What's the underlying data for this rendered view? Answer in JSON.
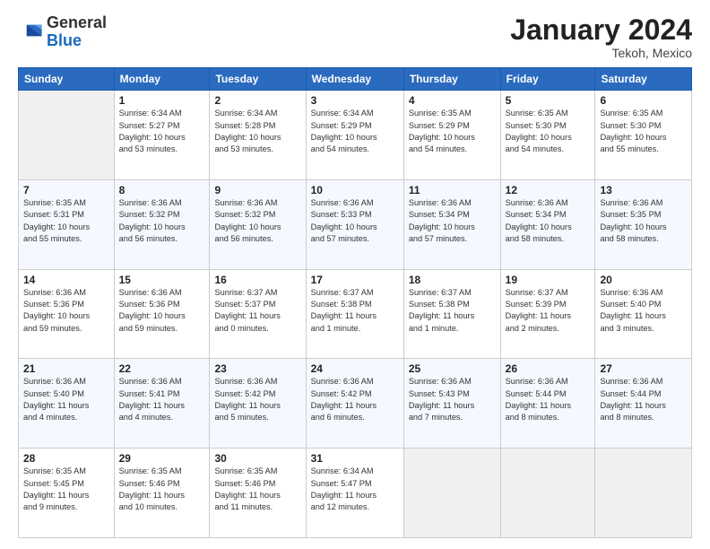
{
  "header": {
    "logo_general": "General",
    "logo_blue": "Blue",
    "month_title": "January 2024",
    "subtitle": "Tekoh, Mexico"
  },
  "calendar": {
    "days_of_week": [
      "Sunday",
      "Monday",
      "Tuesday",
      "Wednesday",
      "Thursday",
      "Friday",
      "Saturday"
    ],
    "weeks": [
      [
        {
          "day": "",
          "info": ""
        },
        {
          "day": "1",
          "info": "Sunrise: 6:34 AM\nSunset: 5:27 PM\nDaylight: 10 hours\nand 53 minutes."
        },
        {
          "day": "2",
          "info": "Sunrise: 6:34 AM\nSunset: 5:28 PM\nDaylight: 10 hours\nand 53 minutes."
        },
        {
          "day": "3",
          "info": "Sunrise: 6:34 AM\nSunset: 5:29 PM\nDaylight: 10 hours\nand 54 minutes."
        },
        {
          "day": "4",
          "info": "Sunrise: 6:35 AM\nSunset: 5:29 PM\nDaylight: 10 hours\nand 54 minutes."
        },
        {
          "day": "5",
          "info": "Sunrise: 6:35 AM\nSunset: 5:30 PM\nDaylight: 10 hours\nand 54 minutes."
        },
        {
          "day": "6",
          "info": "Sunrise: 6:35 AM\nSunset: 5:30 PM\nDaylight: 10 hours\nand 55 minutes."
        }
      ],
      [
        {
          "day": "7",
          "info": "Sunrise: 6:35 AM\nSunset: 5:31 PM\nDaylight: 10 hours\nand 55 minutes."
        },
        {
          "day": "8",
          "info": "Sunrise: 6:36 AM\nSunset: 5:32 PM\nDaylight: 10 hours\nand 56 minutes."
        },
        {
          "day": "9",
          "info": "Sunrise: 6:36 AM\nSunset: 5:32 PM\nDaylight: 10 hours\nand 56 minutes."
        },
        {
          "day": "10",
          "info": "Sunrise: 6:36 AM\nSunset: 5:33 PM\nDaylight: 10 hours\nand 57 minutes."
        },
        {
          "day": "11",
          "info": "Sunrise: 6:36 AM\nSunset: 5:34 PM\nDaylight: 10 hours\nand 57 minutes."
        },
        {
          "day": "12",
          "info": "Sunrise: 6:36 AM\nSunset: 5:34 PM\nDaylight: 10 hours\nand 58 minutes."
        },
        {
          "day": "13",
          "info": "Sunrise: 6:36 AM\nSunset: 5:35 PM\nDaylight: 10 hours\nand 58 minutes."
        }
      ],
      [
        {
          "day": "14",
          "info": "Sunrise: 6:36 AM\nSunset: 5:36 PM\nDaylight: 10 hours\nand 59 minutes."
        },
        {
          "day": "15",
          "info": "Sunrise: 6:36 AM\nSunset: 5:36 PM\nDaylight: 10 hours\nand 59 minutes."
        },
        {
          "day": "16",
          "info": "Sunrise: 6:37 AM\nSunset: 5:37 PM\nDaylight: 11 hours\nand 0 minutes."
        },
        {
          "day": "17",
          "info": "Sunrise: 6:37 AM\nSunset: 5:38 PM\nDaylight: 11 hours\nand 1 minute."
        },
        {
          "day": "18",
          "info": "Sunrise: 6:37 AM\nSunset: 5:38 PM\nDaylight: 11 hours\nand 1 minute."
        },
        {
          "day": "19",
          "info": "Sunrise: 6:37 AM\nSunset: 5:39 PM\nDaylight: 11 hours\nand 2 minutes."
        },
        {
          "day": "20",
          "info": "Sunrise: 6:36 AM\nSunset: 5:40 PM\nDaylight: 11 hours\nand 3 minutes."
        }
      ],
      [
        {
          "day": "21",
          "info": "Sunrise: 6:36 AM\nSunset: 5:40 PM\nDaylight: 11 hours\nand 4 minutes."
        },
        {
          "day": "22",
          "info": "Sunrise: 6:36 AM\nSunset: 5:41 PM\nDaylight: 11 hours\nand 4 minutes."
        },
        {
          "day": "23",
          "info": "Sunrise: 6:36 AM\nSunset: 5:42 PM\nDaylight: 11 hours\nand 5 minutes."
        },
        {
          "day": "24",
          "info": "Sunrise: 6:36 AM\nSunset: 5:42 PM\nDaylight: 11 hours\nand 6 minutes."
        },
        {
          "day": "25",
          "info": "Sunrise: 6:36 AM\nSunset: 5:43 PM\nDaylight: 11 hours\nand 7 minutes."
        },
        {
          "day": "26",
          "info": "Sunrise: 6:36 AM\nSunset: 5:44 PM\nDaylight: 11 hours\nand 8 minutes."
        },
        {
          "day": "27",
          "info": "Sunrise: 6:36 AM\nSunset: 5:44 PM\nDaylight: 11 hours\nand 8 minutes."
        }
      ],
      [
        {
          "day": "28",
          "info": "Sunrise: 6:35 AM\nSunset: 5:45 PM\nDaylight: 11 hours\nand 9 minutes."
        },
        {
          "day": "29",
          "info": "Sunrise: 6:35 AM\nSunset: 5:46 PM\nDaylight: 11 hours\nand 10 minutes."
        },
        {
          "day": "30",
          "info": "Sunrise: 6:35 AM\nSunset: 5:46 PM\nDaylight: 11 hours\nand 11 minutes."
        },
        {
          "day": "31",
          "info": "Sunrise: 6:34 AM\nSunset: 5:47 PM\nDaylight: 11 hours\nand 12 minutes."
        },
        {
          "day": "",
          "info": ""
        },
        {
          "day": "",
          "info": ""
        },
        {
          "day": "",
          "info": ""
        }
      ]
    ]
  }
}
